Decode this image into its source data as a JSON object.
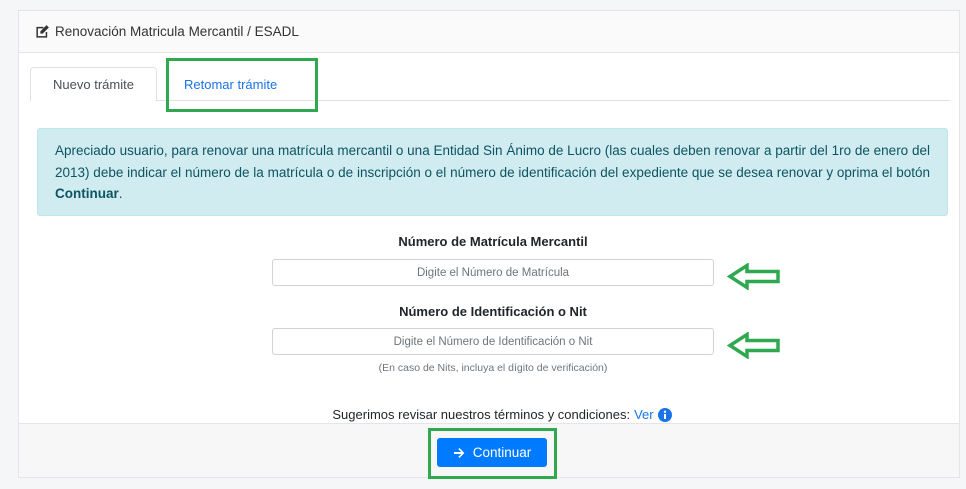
{
  "header": {
    "title": "Renovación Matricula Mercantil / ESADL",
    "icon": "edit-icon"
  },
  "tabs": [
    {
      "label": "Nuevo trámite",
      "active": true
    },
    {
      "label": "Retomar trámite",
      "active": false
    }
  ],
  "alert": {
    "text_before": "Apreciado usuario, para renovar una matrícula mercantil o una Entidad Sin Ánimo de Lucro (las cuales deben renovar a partir del 1ro de enero del 2013) debe indicar el número de la matrícula o de inscripción o el número de identificación del expediente que se desea renovar y oprima el botón ",
    "bold": "Continuar",
    "text_after": "."
  },
  "form": {
    "matricula": {
      "label": "Número de Matrícula Mercantil",
      "placeholder": "Digite el Número de Matrícula",
      "value": ""
    },
    "nit": {
      "label": "Número de Identificación o Nit",
      "placeholder": "Digite el Número de Identificación o Nit",
      "value": "",
      "help": "(En caso de Nits, incluya el dígito de verificación)"
    }
  },
  "terms": {
    "text": "Sugerimos revisar nuestros términos y condiciones:",
    "link": "Ver",
    "icon": "info-circle-icon"
  },
  "footer": {
    "button_label": "Continuar",
    "button_icon": "arrow-right-icon"
  },
  "colors": {
    "primary": "#007bff",
    "link": "#1a73e8",
    "alert_bg": "#d1ecf1",
    "alert_text": "#0c5460",
    "annotation": "#2fa84f"
  }
}
